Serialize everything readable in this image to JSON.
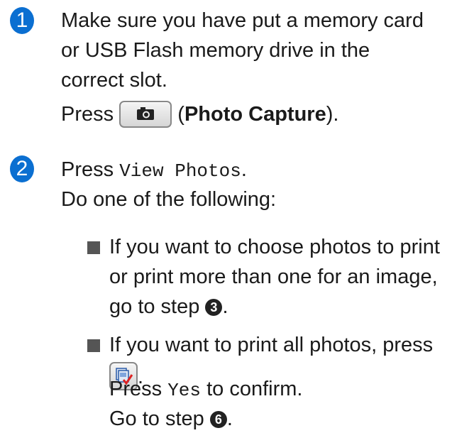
{
  "step1": {
    "number": "1",
    "line1": "Make sure you have put a memory card",
    "line2": "or USB Flash memory drive in the",
    "line3": "correct slot.",
    "press_prefix": "Press",
    "paren_open": "(",
    "photo_capture": "Photo Capture",
    "paren_close": ").",
    "button_icon": "camera-icon"
  },
  "step2": {
    "number": "2",
    "press_prefix": "Press",
    "view_photos": "View Photos",
    "period": ".",
    "intro": "Do one of the following:",
    "bullet1": {
      "line1": "If you want to choose photos to print",
      "line2": "or print more than one for an image,",
      "line3_prefix": "go to step",
      "step_ref": "3",
      "line3_suffix": "."
    },
    "bullet2": {
      "line1": "If you want to print all photos, press",
      "button_icon": "print-all-icon",
      "after_button": ".",
      "press_prefix": "Press",
      "yes": "Yes",
      "confirm_suffix": "to confirm.",
      "goto_prefix": "Go to step",
      "step_ref": "6",
      "goto_suffix": "."
    }
  },
  "colors": {
    "badge": "#0b6fd1",
    "text": "#1a1a1a"
  }
}
